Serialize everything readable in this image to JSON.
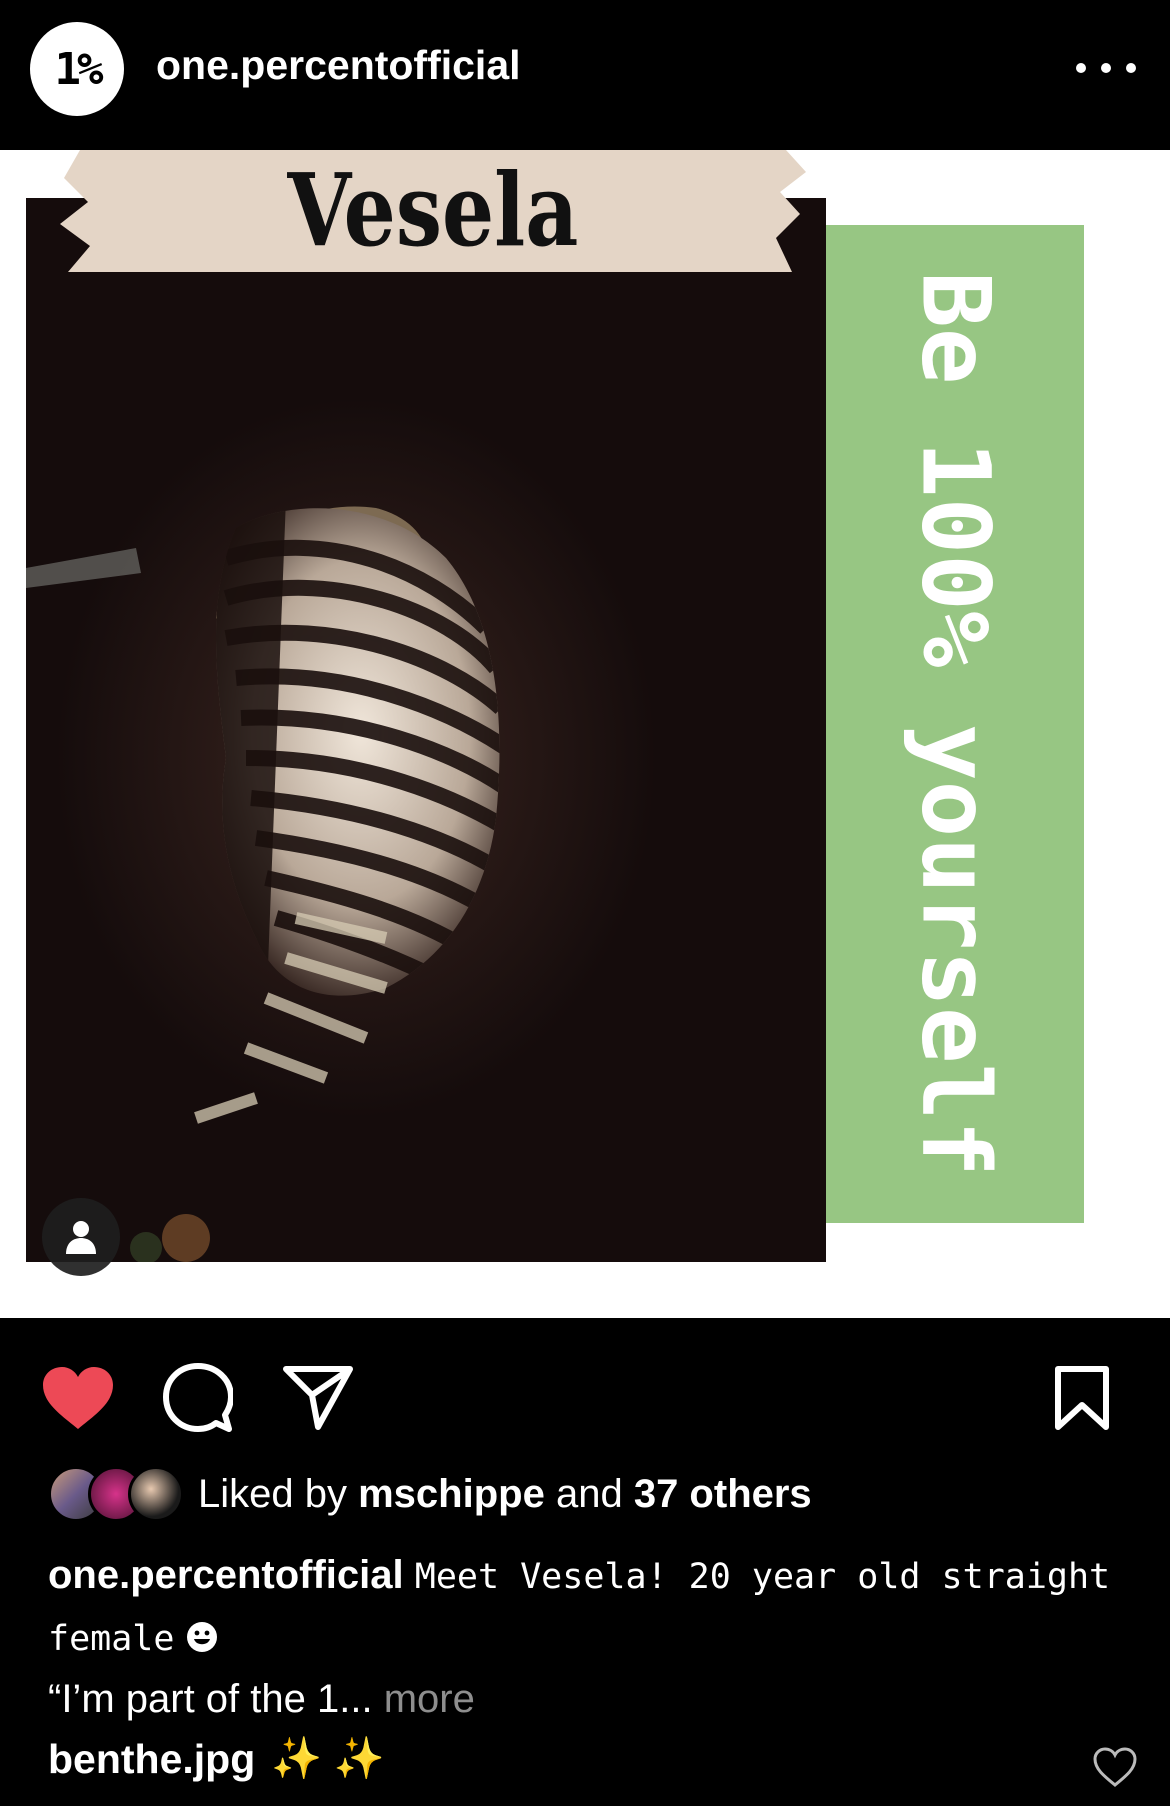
{
  "header": {
    "avatar_text": "1%",
    "username": "one.percentofficial",
    "more_icon": "more-horizontal-icon"
  },
  "post": {
    "banner_title": "Vesela",
    "side_text": "Be 100% yourself",
    "colors": {
      "banner": "#e4d5c6",
      "green_panel": "#97c683",
      "photo_bg": "#150c0c"
    }
  },
  "actions": {
    "like_icon": "heart-filled-icon",
    "like_color": "#ed4956",
    "comment_icon": "comment-icon",
    "share_icon": "paper-plane-icon",
    "save_icon": "bookmark-icon"
  },
  "likes": {
    "prefix": "Liked by",
    "user": "mschippe",
    "middle": "and",
    "others": "37 others"
  },
  "caption": {
    "username": "one.percentofficial",
    "text": "Meet Vesela! 20 year old straight female",
    "line2": "“I’m part of the 1...",
    "more": "more"
  },
  "comment": {
    "username": "benthe.jpg",
    "emoji": "✨ ✨",
    "heart_icon": "heart-outline-icon"
  }
}
